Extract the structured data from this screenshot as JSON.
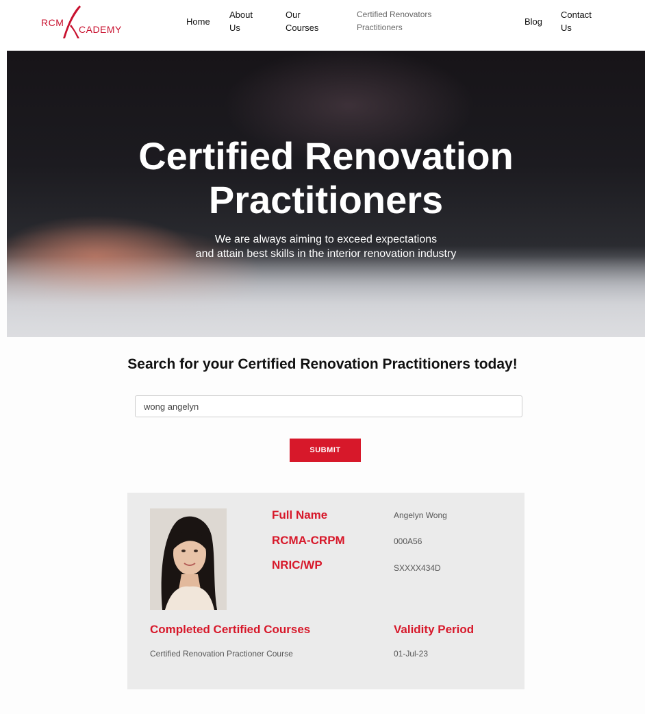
{
  "header": {
    "logo_left": "RCM",
    "logo_right": "CADEMY",
    "nav": {
      "home": "Home",
      "about_1": "About",
      "about_2": "Us",
      "courses_1": "Our",
      "courses_2": "Courses",
      "crp_1": "Certified Renovators",
      "crp_2": "Practitioners",
      "blog": "Blog",
      "contact_1": "Contact",
      "contact_2": "Us"
    }
  },
  "hero": {
    "title_line1": "Certified Renovation",
    "title_line2": "Practitioners",
    "subtitle_line1": "We are always aiming to exceed expectations",
    "subtitle_line2": "and attain best skills in the interior renovation industry"
  },
  "search": {
    "heading": "Search for your Certified Renovation Practitioners today!",
    "value": "wong angelyn",
    "submit_label": "SUBMIT"
  },
  "result": {
    "full_name_label": "Full Name",
    "full_name": "Angelyn Wong",
    "id_label": "RCMA-CRPM",
    "id_value": "000A56",
    "nric_label": "NRIC/WP",
    "nric_value": "SXXXX434D",
    "courses_label": "Completed Certified Courses",
    "course": "Certified Renovation Practioner Course",
    "validity_label": "Validity Period",
    "validity": "01-Jul-23"
  },
  "colors": {
    "brand_red": "#d7182a",
    "card_bg": "#ebebeb"
  }
}
